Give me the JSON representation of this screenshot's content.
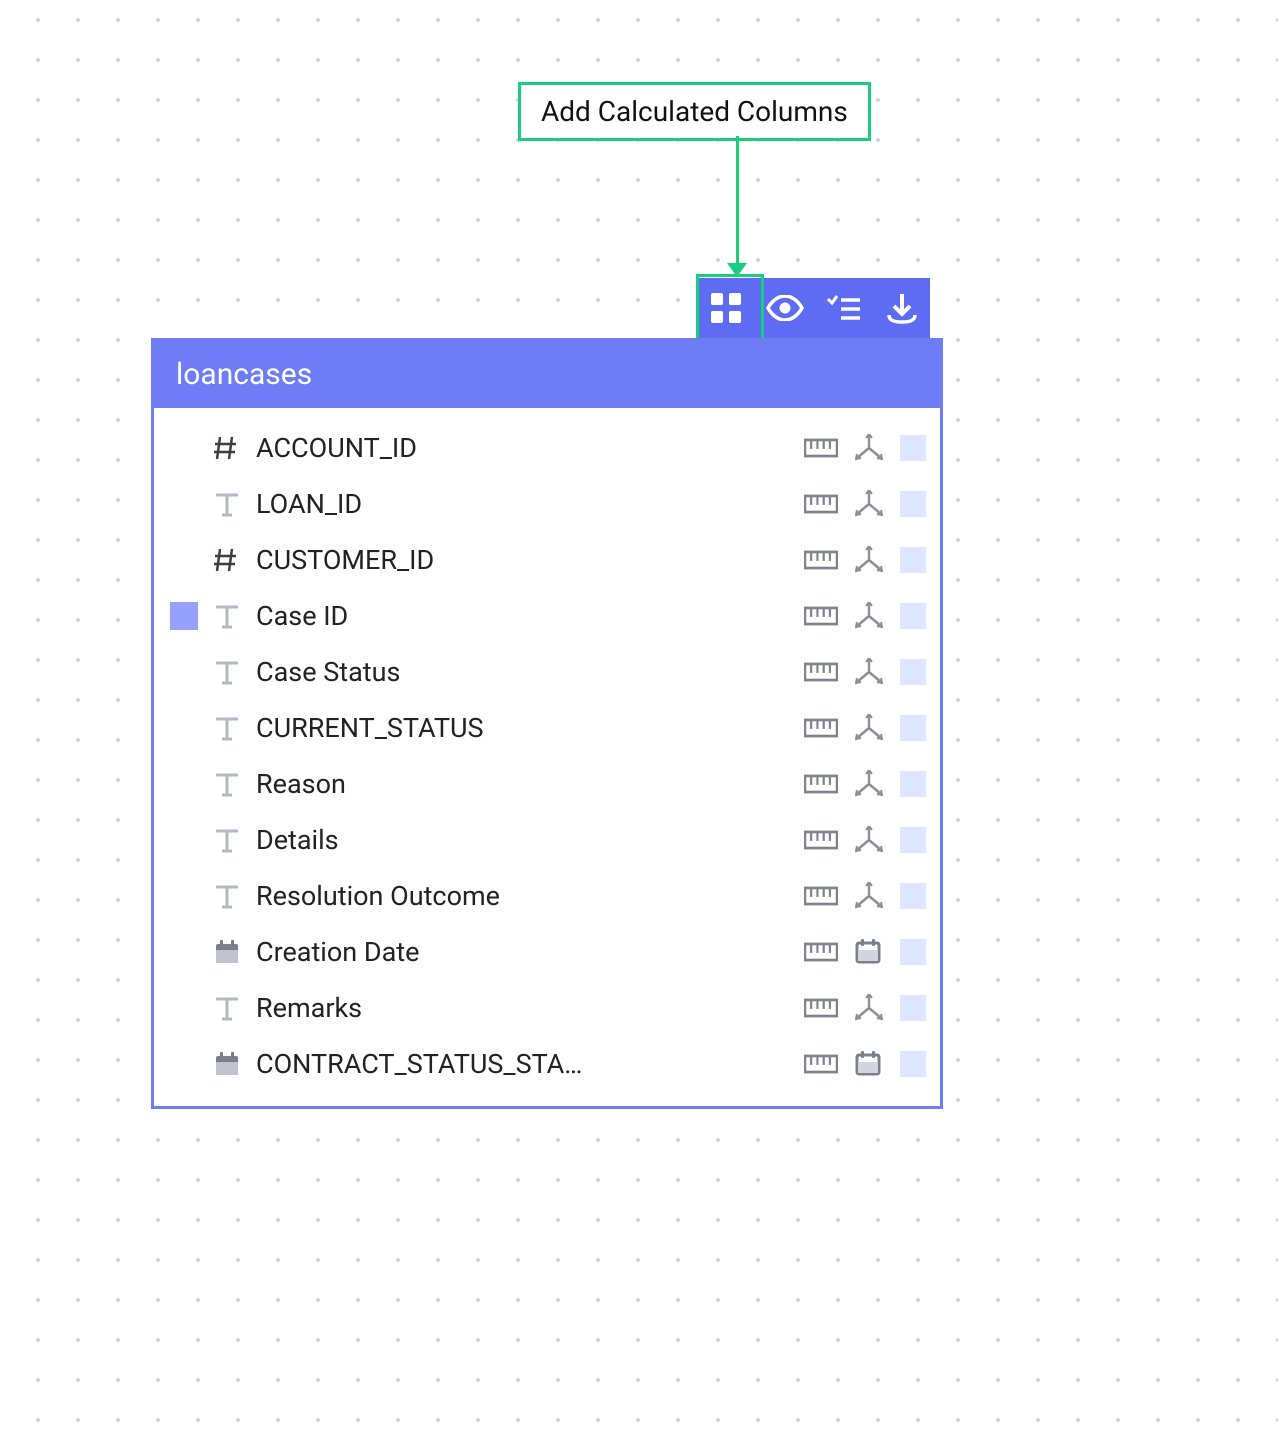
{
  "callout": {
    "label": "Add Calculated Columns"
  },
  "toolbar": {
    "add_calc_label": "Add Calculated Columns",
    "preview_label": "Preview",
    "select_label": "Select list",
    "download_label": "Download"
  },
  "panel": {
    "title": "loancases",
    "fields": [
      {
        "name": "ACCOUNT_ID",
        "type": "number",
        "marker": false,
        "actions": [
          "measure",
          "dimension"
        ]
      },
      {
        "name": "LOAN_ID",
        "type": "text",
        "marker": false,
        "actions": [
          "measure",
          "dimension"
        ]
      },
      {
        "name": "CUSTOMER_ID",
        "type": "number",
        "marker": false,
        "actions": [
          "measure",
          "dimension"
        ]
      },
      {
        "name": "Case ID",
        "type": "text",
        "marker": true,
        "actions": [
          "measure",
          "dimension"
        ]
      },
      {
        "name": "Case Status",
        "type": "text",
        "marker": false,
        "actions": [
          "measure",
          "dimension"
        ]
      },
      {
        "name": "CURRENT_STATUS",
        "type": "text",
        "marker": false,
        "actions": [
          "measure",
          "dimension"
        ]
      },
      {
        "name": "Reason",
        "type": "text",
        "marker": false,
        "actions": [
          "measure",
          "dimension"
        ]
      },
      {
        "name": "Details",
        "type": "text",
        "marker": false,
        "actions": [
          "measure",
          "dimension"
        ]
      },
      {
        "name": "Resolution Outcome",
        "type": "text",
        "marker": false,
        "actions": [
          "measure",
          "dimension"
        ]
      },
      {
        "name": "Creation Date",
        "type": "date",
        "marker": false,
        "actions": [
          "measure",
          "date"
        ]
      },
      {
        "name": "Remarks",
        "type": "text",
        "marker": false,
        "actions": [
          "measure",
          "dimension"
        ]
      },
      {
        "name": "CONTRACT_STATUS_STA…",
        "type": "date",
        "marker": false,
        "actions": [
          "measure",
          "date"
        ]
      }
    ]
  },
  "colors": {
    "accent": "#6e7cf5",
    "highlight": "#17cf7f",
    "icon-grey": "#8a8f9d",
    "icon-dark": "#5a5f6b",
    "checkbox": "#e0e6ff"
  }
}
